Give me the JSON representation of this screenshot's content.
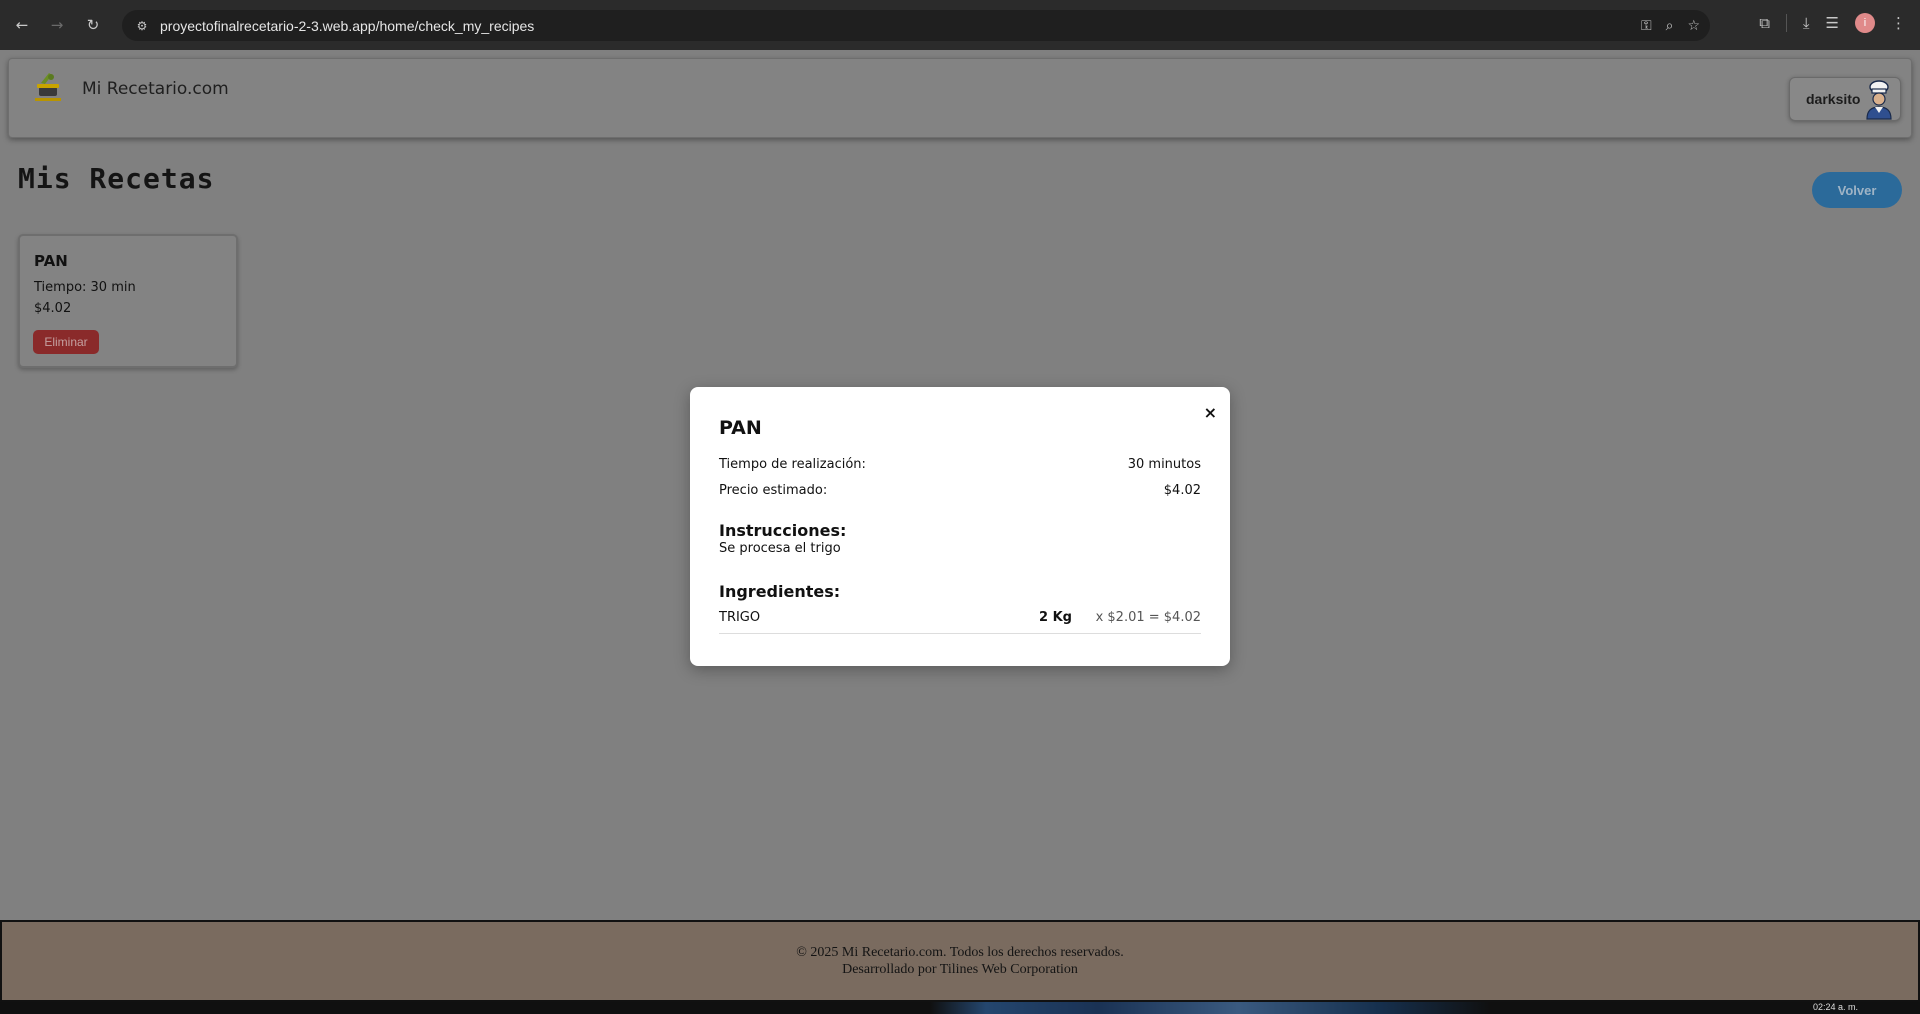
{
  "browser": {
    "url": "proyectofinalrecetario-2-3.web.app/home/check_my_recipes",
    "profile_initial": "i"
  },
  "header": {
    "app_title": "Mi Recetario.com",
    "username": "darksito"
  },
  "page": {
    "title": "Mis Recetas",
    "back_label": "Volver"
  },
  "recipes": [
    {
      "name": "PAN",
      "time": "Tiempo: 30 min",
      "price": "$4.02",
      "delete_label": "Eliminar"
    }
  ],
  "modal": {
    "close_symbol": "×",
    "title": "PAN",
    "time_label": "Tiempo de realización:",
    "time_value": "30 minutos",
    "price_label": "Precio estimado:",
    "price_value": "$4.02",
    "instructions_heading": "Instrucciones:",
    "instructions_text": "Se procesa el trigo",
    "ingredients_heading": "Ingredientes:",
    "ingredients": [
      {
        "name": "TRIGO",
        "quantity": "2 Kg",
        "calc": "x $2.01 = $4.02"
      }
    ]
  },
  "footer": {
    "line1": "© 2025 Mi Recetario.com. Todos los derechos reservados.",
    "line2": "Desarrollado por Tilines Web Corporation"
  },
  "taskbar": {
    "clock": "02:24 a. m."
  },
  "colors": {
    "overlay_bg": "#808080",
    "volver_button": "#2b6a9a",
    "delete_button": "#8a2a2a",
    "footer_bg": "#7a6b5f"
  }
}
